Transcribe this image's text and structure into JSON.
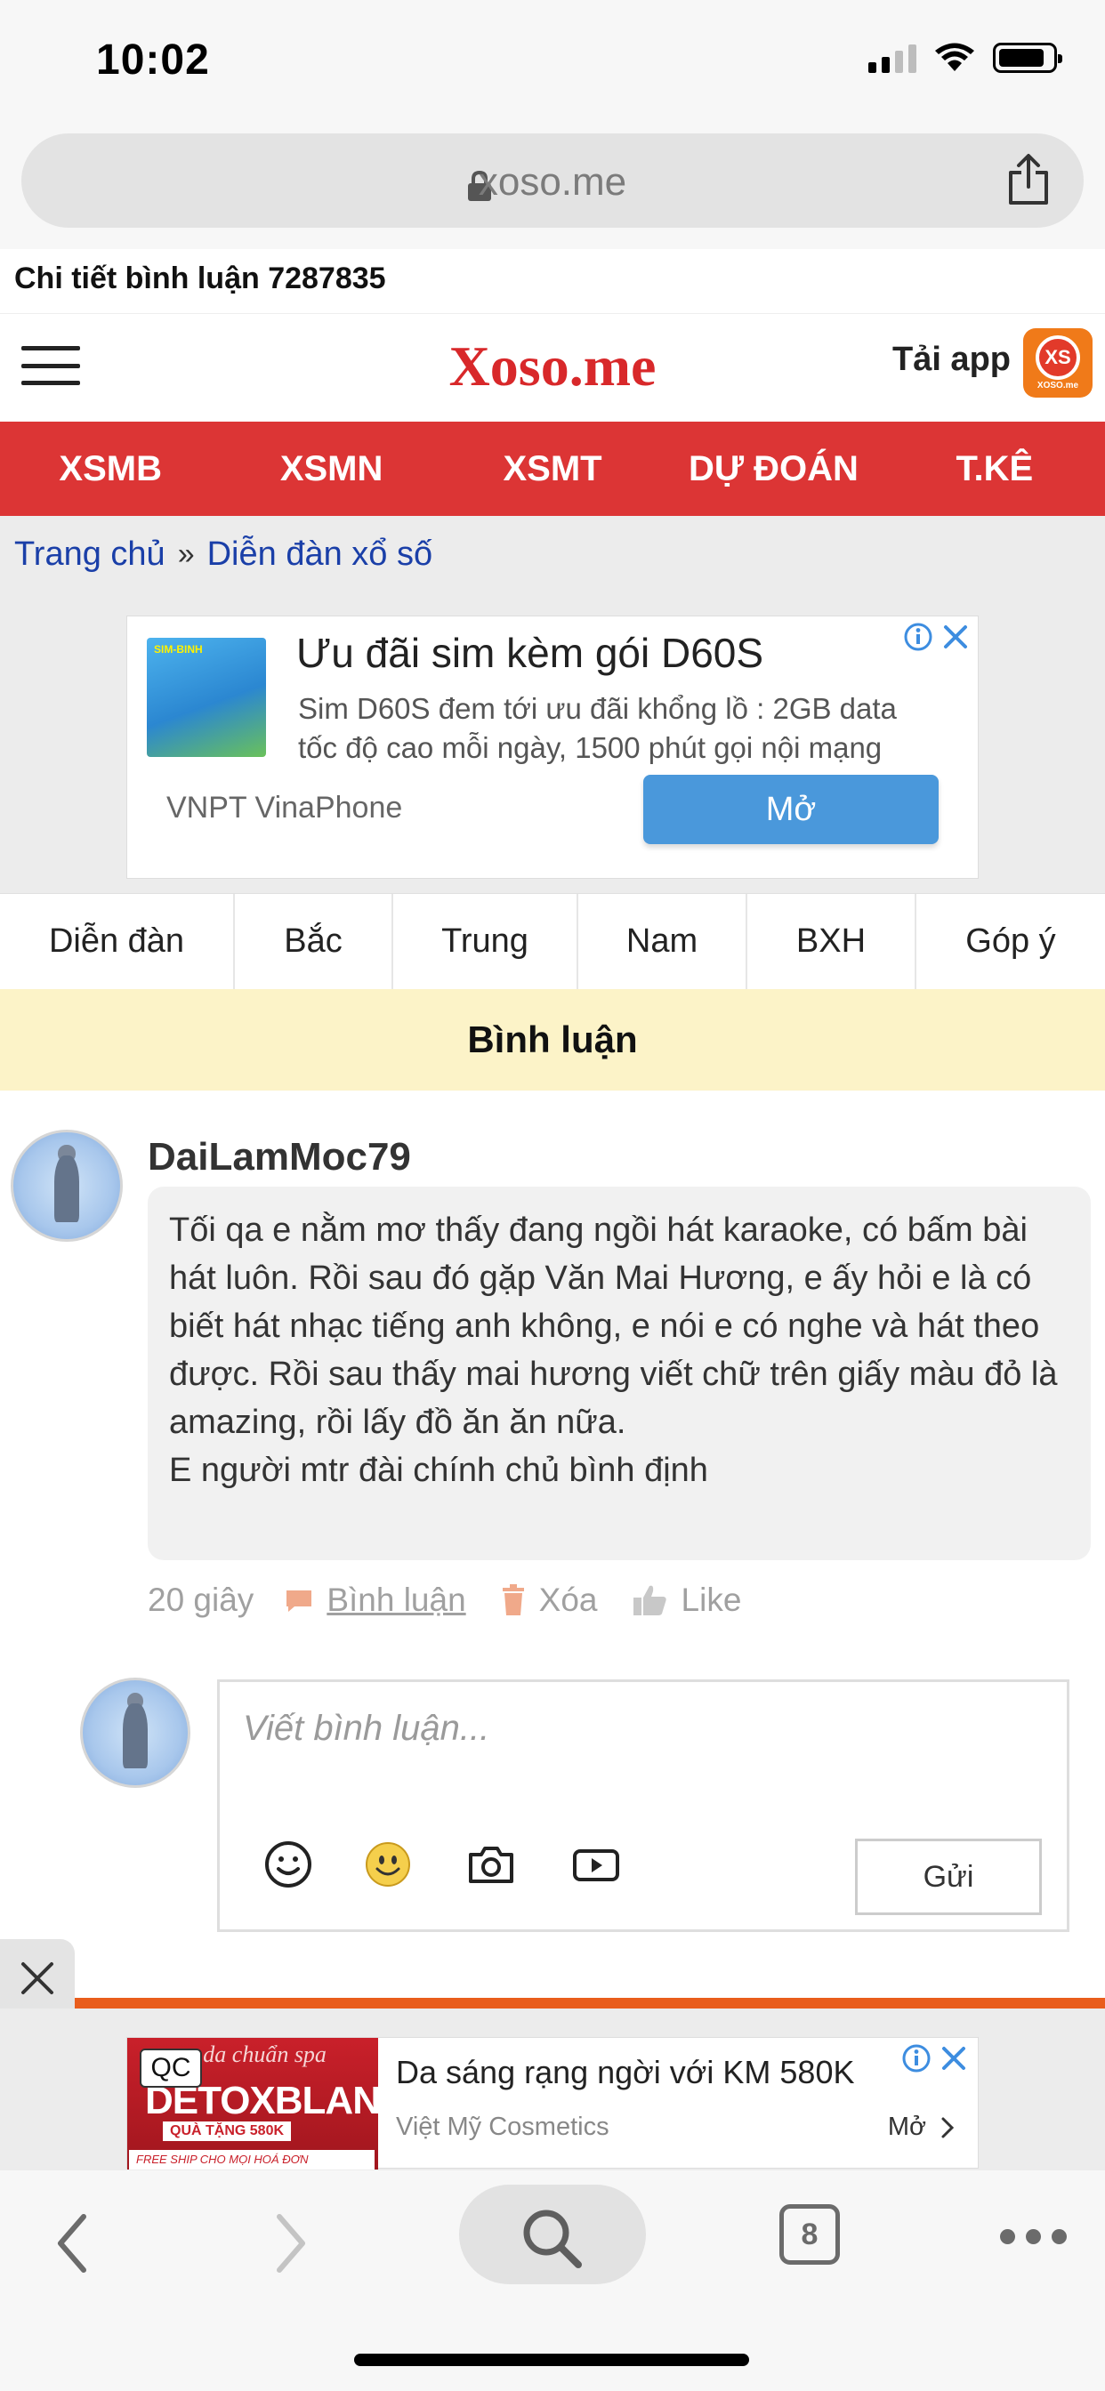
{
  "status_bar": {
    "time": "10:02"
  },
  "browser": {
    "url": "xoso.me",
    "open_tabs": "8"
  },
  "page_heading": "Chi tiết bình luận 7287835",
  "site": {
    "logo": "Xoso.me",
    "app_label": "Tải app",
    "app_icon_text": "XS",
    "app_icon_subtext": "XOSO.me",
    "accent_color": "#dc3535"
  },
  "main_nav": [
    "XSMB",
    "XSMN",
    "XSMT",
    "DỰ ĐOÁN",
    "T.KÊ"
  ],
  "breadcrumb": {
    "home": "Trang chủ",
    "separator": "»",
    "current": "Diễn đàn xổ số"
  },
  "ad_top": {
    "title": "Ưu đãi sim kèm gói D60S",
    "description": "Sim D60S đem tới ưu đãi khổng lồ : 2GB data tốc độ cao mỗi ngày, 1500 phút gọi nội mạng",
    "advertiser": "VNPT VinaPhone",
    "cta": "Mở",
    "thumb_badge": "SIM-BINH"
  },
  "forum_tabs": [
    "Diễn đàn",
    "Bắc",
    "Trung",
    "Nam",
    "BXH",
    "Góp ý"
  ],
  "comment_section_title": "Bình luận",
  "comment": {
    "author": "DaiLamMoc79",
    "text": "Tối qa e nằm mơ thấy đang ngồi hát karaoke, có bấm bài hát luôn. Rồi sau đó gặp Văn Mai Hương, e ấy hỏi e là có biết hát nhạc tiếng anh không, e nói e có nghe và hát theo được. Rồi sau thấy mai hương viết chữ trên giấy màu đỏ là amazing, rồi lấy đồ ăn ăn nữa.\nE người mtr đài chính chủ bình định",
    "time": "20 giây",
    "reply_label": "Bình luận",
    "delete_label": "Xóa",
    "like_label": "Like"
  },
  "compose": {
    "placeholder": "Viết bình luận...",
    "send_label": "Gửi"
  },
  "ad_bottom": {
    "badge": "QC",
    "brand": "DETOXBLANC",
    "script": "m da chuẩn spa",
    "gift": "QUÀ TẶNG 580K",
    "shipping": "FREE SHIP CHO MỌI HOÁ ĐƠN",
    "title": "Da sáng rạng ngời với KM 580K",
    "advertiser": "Việt Mỹ Cosmetics",
    "cta": "Mở"
  }
}
